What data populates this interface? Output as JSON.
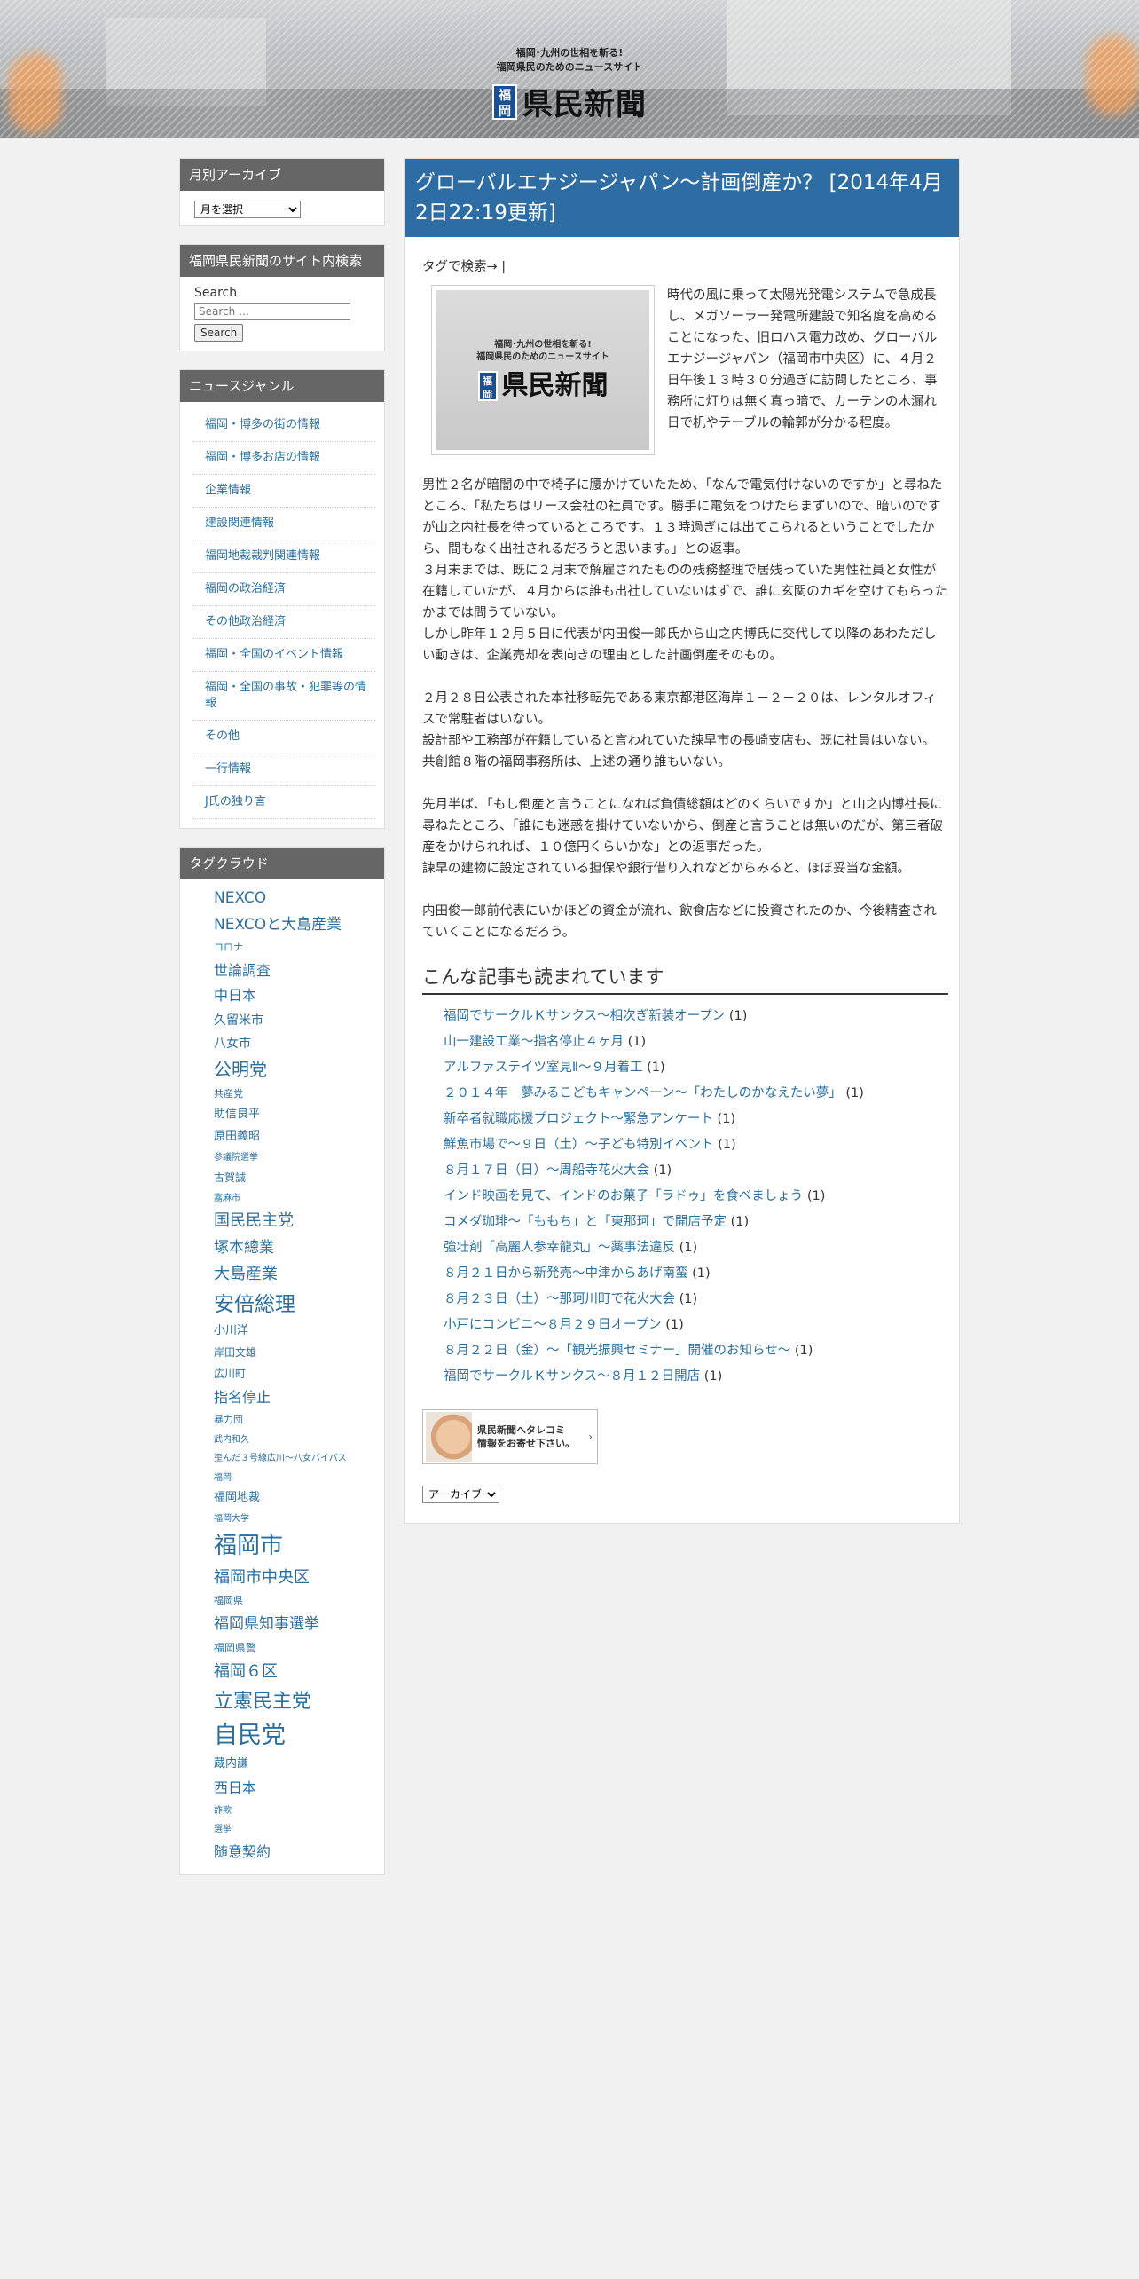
{
  "header": {
    "tagline_1": "福岡･九州の世相を斬る!",
    "tagline_2": "福岡県民のためのニュースサイト",
    "logo_badge": "福岡",
    "logo_text": "県民新聞"
  },
  "sidebar": {
    "archive": {
      "title": "月別アーカイブ",
      "select_value": "月を選択"
    },
    "search": {
      "title": "福岡県民新聞のサイト内検索",
      "label": "Search",
      "placeholder": "Search …",
      "button": "Search"
    },
    "genres": {
      "title": "ニュースジャンル",
      "items": [
        "福岡・博多の街の情報",
        "福岡・博多お店の情報",
        "企業情報",
        "建設関連情報",
        "福岡地裁裁判関連情報",
        "福岡の政治経済",
        "その他政治経済",
        "福岡・全国のイベント情報",
        "福岡・全国の事故・犯罪等の情報",
        "その他",
        "一行情報",
        "J氏の独り言"
      ]
    },
    "tag_cloud": {
      "title": "タグクラウド",
      "tags": [
        {
          "label": "NEXCO",
          "size": 17
        },
        {
          "label": "NEXCOと大島産業",
          "size": 17
        },
        {
          "label": "コロナ",
          "size": 11
        },
        {
          "label": "世論調査",
          "size": 16
        },
        {
          "label": "中日本",
          "size": 16
        },
        {
          "label": "久留米市",
          "size": 14
        },
        {
          "label": "八女市",
          "size": 14
        },
        {
          "label": "公明党",
          "size": 20
        },
        {
          "label": "共産党",
          "size": 11
        },
        {
          "label": "助信良平",
          "size": 13
        },
        {
          "label": "原田義昭",
          "size": 13
        },
        {
          "label": "参議院選挙",
          "size": 10
        },
        {
          "label": "古賀誠",
          "size": 12
        },
        {
          "label": "嘉麻市",
          "size": 10
        },
        {
          "label": "国民民主党",
          "size": 18
        },
        {
          "label": "塚本總業",
          "size": 17
        },
        {
          "label": "大島産業",
          "size": 18
        },
        {
          "label": "安倍総理",
          "size": 23
        },
        {
          "label": "小川洋",
          "size": 13
        },
        {
          "label": "岸田文雄",
          "size": 12
        },
        {
          "label": "広川町",
          "size": 12
        },
        {
          "label": "指名停止",
          "size": 16
        },
        {
          "label": "暴力団",
          "size": 11
        },
        {
          "label": "武内和久",
          "size": 10
        },
        {
          "label": "歪んだ３号線広川～八女バイパス",
          "size": 10
        },
        {
          "label": "福岡",
          "size": 10
        },
        {
          "label": "福岡地裁",
          "size": 13
        },
        {
          "label": "福岡大学",
          "size": 10
        },
        {
          "label": "福岡市",
          "size": 26
        },
        {
          "label": "福岡市中央区",
          "size": 18
        },
        {
          "label": "福岡県",
          "size": 11
        },
        {
          "label": "福岡県知事選挙",
          "size": 17
        },
        {
          "label": "福岡県警",
          "size": 12
        },
        {
          "label": "福岡６区",
          "size": 18
        },
        {
          "label": "立憲民主党",
          "size": 22
        },
        {
          "label": "自民党",
          "size": 27
        },
        {
          "label": "蔵内謙",
          "size": 13
        },
        {
          "label": "西日本",
          "size": 16
        },
        {
          "label": "詐欺",
          "size": 10
        },
        {
          "label": "選挙",
          "size": 10
        },
        {
          "label": "随意契約",
          "size": 16
        }
      ]
    }
  },
  "article": {
    "title": "グローバルエナジージャパン～計画倒産か？ [2014年4月2日22:19更新]",
    "tag_search": "タグで検索→ |",
    "thumb_tagline_1": "福岡･九州の世相を斬る!",
    "thumb_tagline_2": "福岡県民のためのニュースサイト",
    "thumb_badge": "福岡",
    "thumb_logo": "県民新聞",
    "intro": "時代の風に乗って太陽光発電システムで急成長し、メガソーラー発電所建設で知名度を高めることになった、旧ロハス電力改め、グローバルエナジージャパン（福岡市中央区）に、４月２日午後１３時３０分過ぎに訪問したところ、事務所に灯りは無く真っ暗で、カーテンの木漏れ日で机やテーブルの輪郭が分かる程度。",
    "p1": "男性２名が暗闇の中で椅子に腰かけていたため、「なんで電気付けないのですか」と尋ねたところ、「私たちはリース会社の社員です。勝手に電気をつけたらまずいので、暗いのですが山之内社長を待っているところです。１３時過ぎには出てこられるということでしたから、間もなく出社されるだろうと思います。」との返事。",
    "p2": "３月末までは、既に２月末で解雇されたものの残務整理で居残っていた男性社員と女性が在籍していたが、４月からは誰も出社していないはずで、誰に玄関のカギを空けてもらったかまでは問うていない。",
    "p3": "しかし昨年１２月５日に代表が内田俊一郎氏から山之内博氏に交代して以降のあわただしい動きは、企業売却を表向きの理由とした計画倒産そのもの。",
    "p4": "２月２８日公表された本社移転先である東京都港区海岸１－２－２０は、レンタルオフィスで常駐者はいない。",
    "p5": "設計部や工務部が在籍していると言われていた諫早市の長崎支店も、既に社員はいない。",
    "p6": "共創館８階の福岡事務所は、上述の通り誰もいない。",
    "p7": "先月半ば、「もし倒産と言うことになれば負債総額はどのくらいですか」と山之内博社長に尋ねたところ、「誰にも迷惑を掛けていないから、倒産と言うことは無いのだが、第三者破産をかけられれば、１０億円くらいかな」との返事だった。",
    "p8": "諫早の建物に設定されている担保や銀行借り入れなどからみると、ほぼ妥当な金額。",
    "p9": "内田俊一郎前代表にいかほどの資金が流れ、飲食店などに投資されたのか、今後精査されていくことになるだろう。"
  },
  "related": {
    "heading": "こんな記事も読まれています",
    "items": [
      {
        "title": "福岡でサークルＫサンクス～相次ぎ新装オープン",
        "count": "(1)"
      },
      {
        "title": "山一建設工業～指名停止４ヶ月",
        "count": "(1)"
      },
      {
        "title": "アルファステイツ室見Ⅱ～９月着工",
        "count": "(1)"
      },
      {
        "title": "２０１４年　夢みるこどもキャンペーン～「わたしのかなえたい夢」",
        "count": "(1)"
      },
      {
        "title": "新卒者就職応援プロジェクト～緊急アンケート",
        "count": "(1)"
      },
      {
        "title": "鮮魚市場で～９日（土）～子ども特別イベント",
        "count": "(1)"
      },
      {
        "title": "８月１７日（日）～周船寺花火大会",
        "count": "(1)"
      },
      {
        "title": "インド映画を見て、インドのお菓子「ラドゥ」を食べましょう",
        "count": "(1)"
      },
      {
        "title": "コメダ珈琲～「ももち」と「東那珂」で開店予定",
        "count": "(1)"
      },
      {
        "title": "強壮剤「高麗人参幸龍丸」～薬事法違反",
        "count": "(1)"
      },
      {
        "title": "８月２１日から新発売～中津からあげ南蛮",
        "count": "(1)"
      },
      {
        "title": "８月２３日（土）～那珂川町で花火大会",
        "count": "(1)"
      },
      {
        "title": "小戸にコンビニ～８月２９日オープン",
        "count": "(1)"
      },
      {
        "title": "８月２２日（金）～「観光振興セミナー」開催のお知らせ～",
        "count": "(1)"
      },
      {
        "title": "福岡でサークルＫサンクス～８月１２日開店",
        "count": "(1)"
      }
    ]
  },
  "tip_banner": {
    "line1": "県民新聞へタレコミ",
    "line2": "情報をお寄せ下さい。",
    "arrow": "›"
  },
  "archive_dropdown": {
    "select_value": "アーカイブ"
  }
}
